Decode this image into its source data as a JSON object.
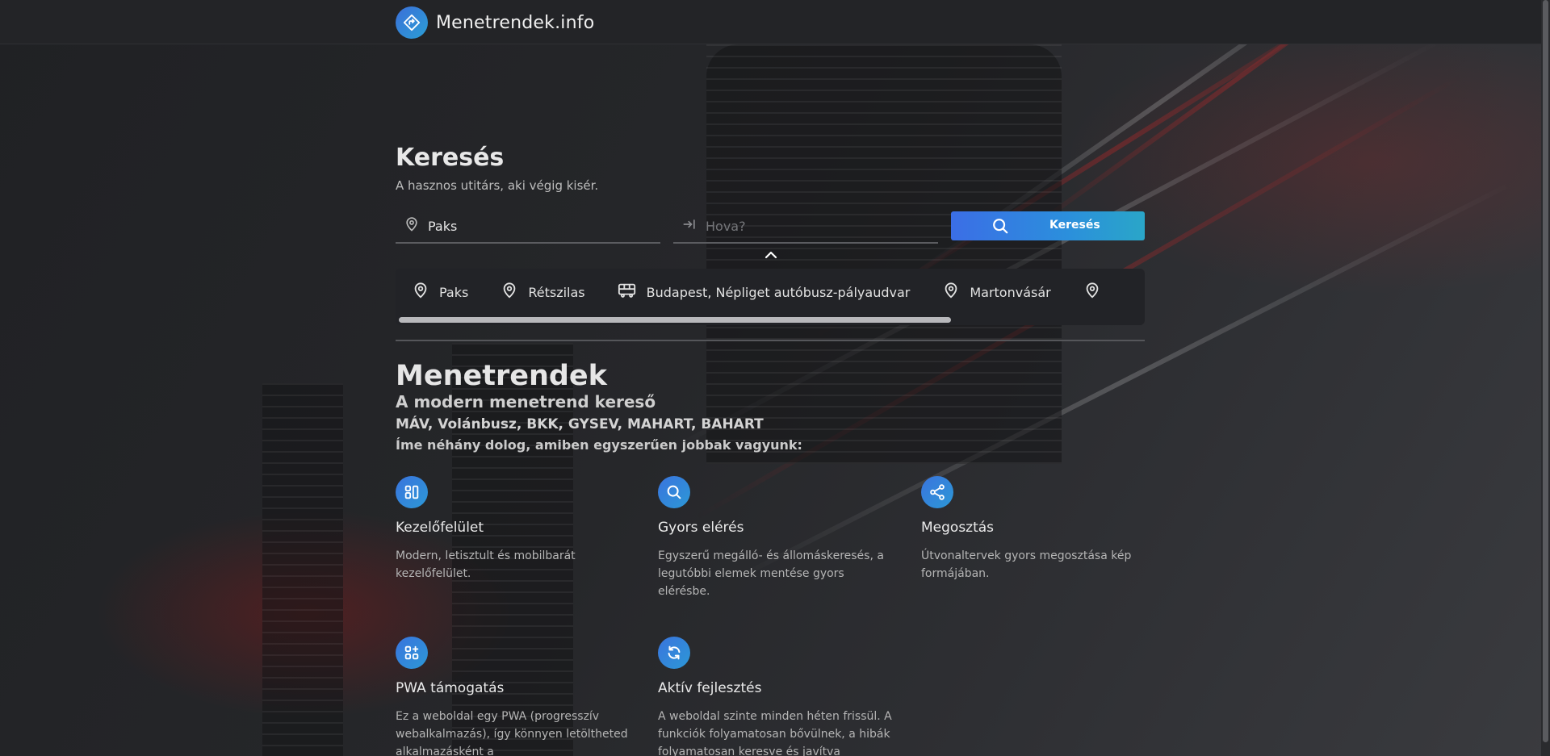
{
  "header": {
    "brand_name": "Menetrendek.info"
  },
  "search": {
    "title": "Keresés",
    "subtitle": "A hasznos utitárs, aki végig kisér.",
    "from_value": "Paks",
    "to_placeholder": "Hova?",
    "button_label": "Keresés"
  },
  "recent": {
    "items": [
      {
        "label": "Paks",
        "icon": "location-pin-icon"
      },
      {
        "label": "Rétszilas",
        "icon": "location-pin-icon"
      },
      {
        "label": "Budapest, Népliget autóbusz-pályaudvar",
        "icon": "bus-icon"
      },
      {
        "label": "Martonvásár",
        "icon": "location-pin-icon"
      },
      {
        "label": "",
        "icon": "location-pin-icon"
      }
    ]
  },
  "about": {
    "title": "Menetrendek",
    "subtitle": "A modern menetrend kereső",
    "operators": "MÁV, Volánbusz, BKK, GYSEV, MAHART, BAHART",
    "intro": "Íme néhány dolog, amiben egyszerűen jobbak vagyunk:"
  },
  "features": [
    {
      "title": "Kezelőfelület",
      "text": "Modern, letisztult és mobilbarát kezelőfelület.",
      "icon": "layout-icon"
    },
    {
      "title": "Gyors elérés",
      "text": "Egyszerű megálló- és állomáskeresés, a legutóbbi elemek mentése gyors elérésbe.",
      "icon": "search-icon"
    },
    {
      "title": "Megosztás",
      "text": "Útvonaltervek gyors megosztása kép formájában.",
      "icon": "share-icon"
    },
    {
      "title": "PWA támogatás",
      "text": "Ez a weboldal egy PWA (progresszív webalkalmazás), így könnyen letöltheted alkalmazásként a",
      "icon": "apps-add-icon"
    },
    {
      "title": "Aktív fejlesztés",
      "text": "A weboldal szinte minden héten frissül. A funkciók folyamatosan bővülnek, a hibák folyamatosan keresve és javítva",
      "icon": "refresh-icon"
    }
  ],
  "colors": {
    "accent_start": "#3b6ee6",
    "accent_end": "#2aa6c8",
    "page_bg": "#232427"
  }
}
